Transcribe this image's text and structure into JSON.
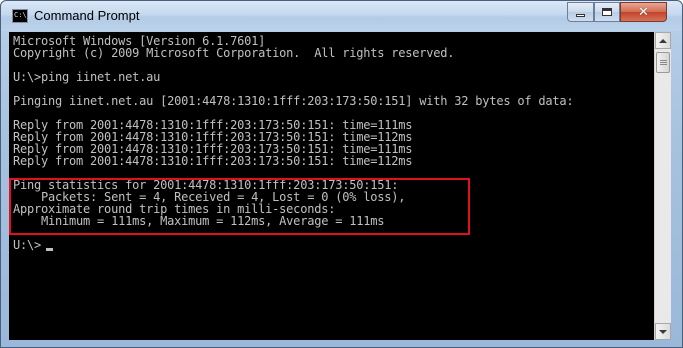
{
  "window": {
    "title": "Command Prompt",
    "icon_text": "C:\\_"
  },
  "controls": {
    "minimize_icon": "minimize-icon",
    "maximize_icon": "maximize-icon",
    "close_icon": "close-icon",
    "close_glyph": "✕"
  },
  "console": {
    "lines": [
      "Microsoft Windows [Version 6.1.7601]",
      "Copyright (c) 2009 Microsoft Corporation.  All rights reserved.",
      "",
      "U:\\>ping iinet.net.au",
      "",
      "Pinging iinet.net.au [2001:4478:1310:1fff:203:173:50:151] with 32 bytes of data:",
      "",
      "Reply from 2001:4478:1310:1fff:203:173:50:151: time=111ms",
      "Reply from 2001:4478:1310:1fff:203:173:50:151: time=112ms",
      "Reply from 2001:4478:1310:1fff:203:173:50:151: time=111ms",
      "Reply from 2001:4478:1310:1fff:203:173:50:151: time=112ms",
      "",
      "Ping statistics for 2001:4478:1310:1fff:203:173:50:151:",
      "    Packets: Sent = 4, Received = 4, Lost = 0 (0% loss),",
      "Approximate round trip times in milli-seconds:",
      "    Minimum = 111ms, Maximum = 112ms, Average = 111ms",
      "",
      "U:\\>"
    ],
    "text_color": "#c0c0c0",
    "background": "#000000",
    "highlight_color": "#e0111b"
  }
}
